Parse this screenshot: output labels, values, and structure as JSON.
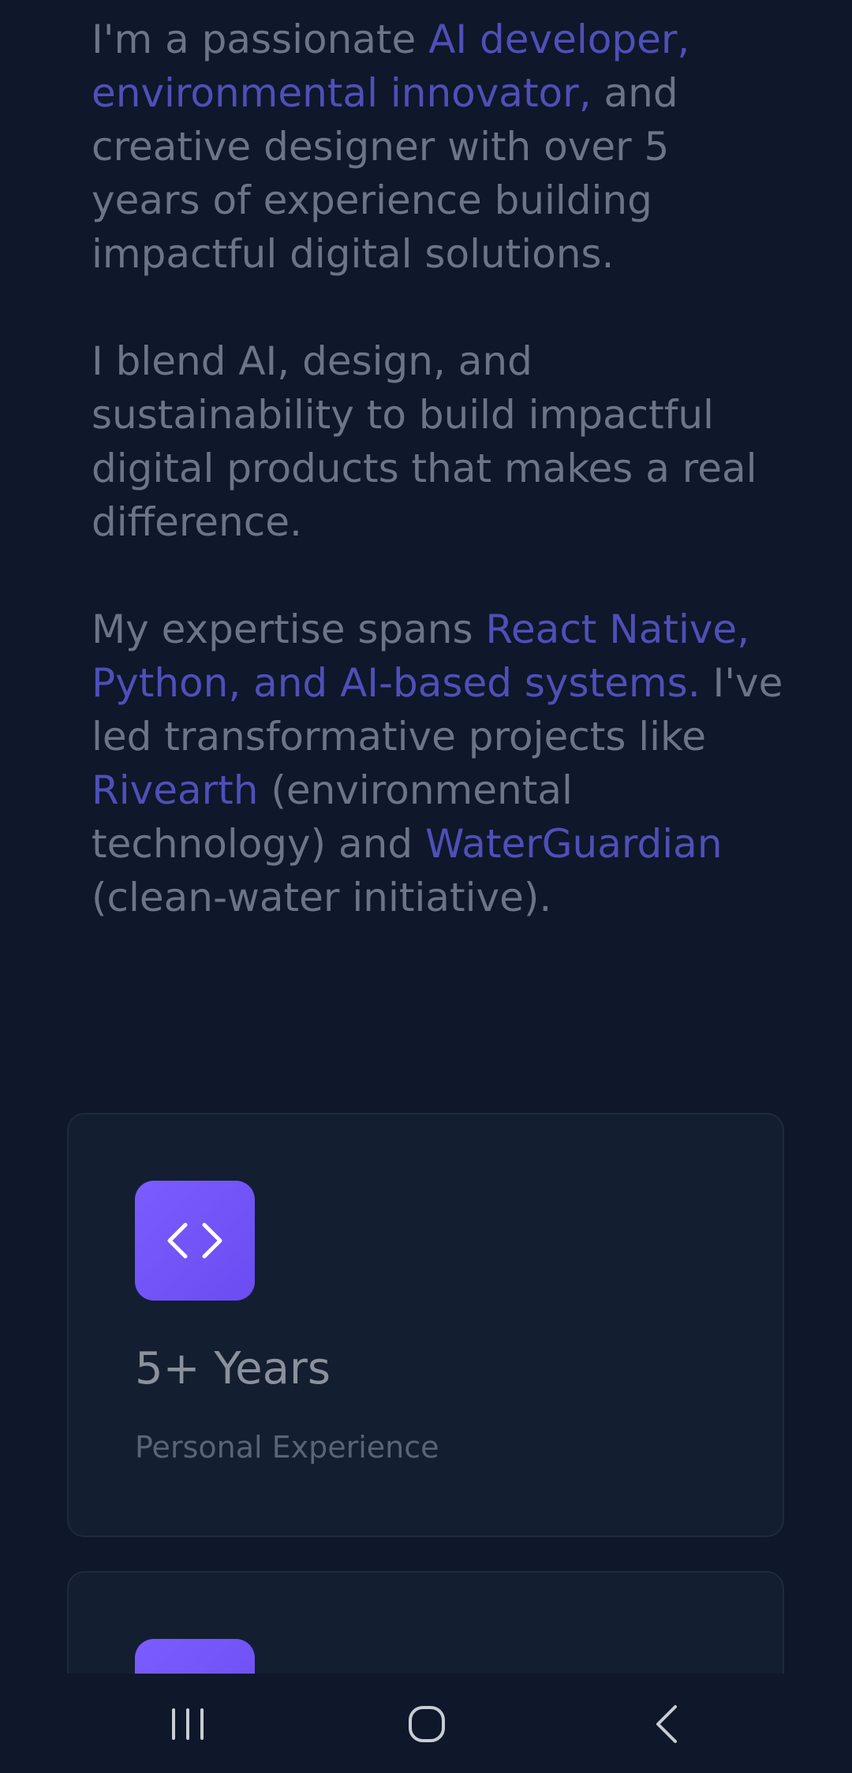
{
  "about": {
    "p1": {
      "t1": "I'm a passionate ",
      "h1": "AI developer, environmental innovator,",
      "t2": " and creative designer with over 5 years of experience building impactful digital solutions."
    },
    "p2": {
      "t1": "I blend AI, design, and sustainability to build impactful digital products that makes a real difference."
    },
    "p3": {
      "t1": "My expertise spans ",
      "h1": "React Native, Python, and AI-based systems.",
      "t2": " I've led transformative projects like ",
      "h2": "Rivearth",
      "t3": " (environmental technology) and ",
      "h3": "WaterGuardian",
      "t4": " (clean-water initiative)."
    }
  },
  "stats": [
    {
      "icon": "code-icon",
      "value": "5+ Years",
      "label": "Personal Experience"
    },
    {
      "icon": "stat-icon"
    }
  ],
  "system_nav": {
    "recents": "recents-icon",
    "home": "home-icon",
    "back": "back-icon"
  },
  "colors": {
    "background": "#0f172a",
    "card": "#141e31",
    "highlight": "#4f4fb8",
    "body_text": "#6b7587",
    "accent": "#7a5cff"
  }
}
